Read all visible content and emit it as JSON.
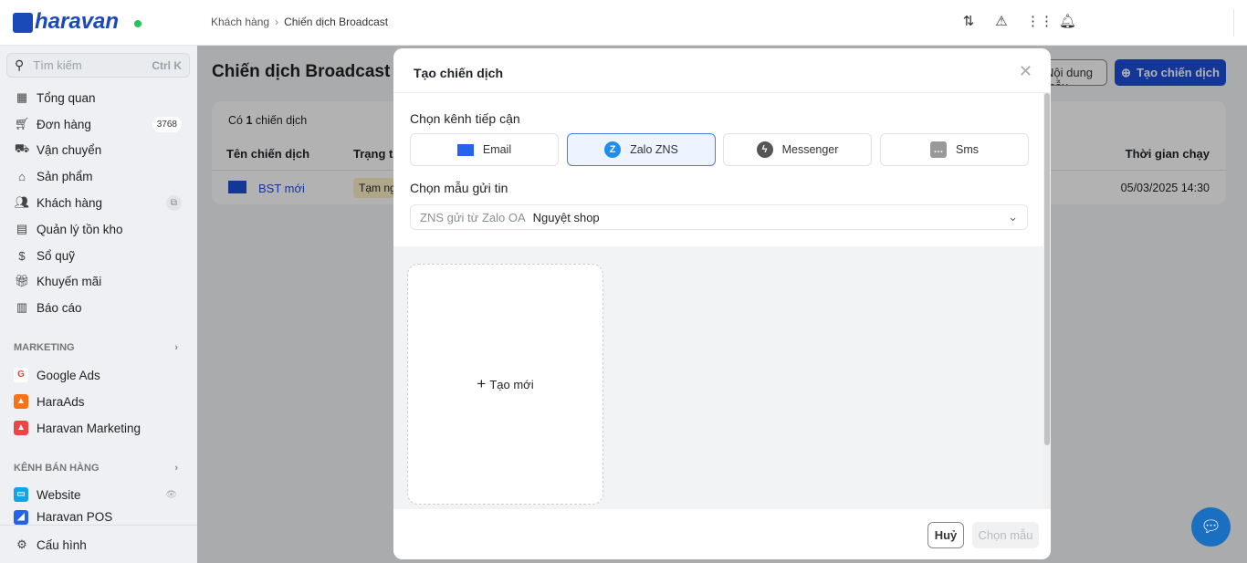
{
  "header": {
    "logo": "haravan",
    "breadcrumb": [
      "Khách hàng",
      "Chiến dịch Broadcast"
    ]
  },
  "sidebar": {
    "search_placeholder": "Tìm kiếm",
    "search_shortcut": "Ctrl K",
    "items": [
      {
        "label": "Tổng quan"
      },
      {
        "label": "Đơn hàng",
        "badge": "3768"
      },
      {
        "label": "Vận chuyển"
      },
      {
        "label": "Sản phẩm"
      },
      {
        "label": "Khách hàng"
      },
      {
        "label": "Quản lý tồn kho"
      },
      {
        "label": "Sổ quỹ"
      },
      {
        "label": "Khuyến mãi"
      },
      {
        "label": "Báo cáo"
      }
    ],
    "marketing_title": "MARKETING",
    "marketing": [
      {
        "label": "Google Ads"
      },
      {
        "label": "HaraAds"
      },
      {
        "label": "Haravan Marketing"
      }
    ],
    "channels_title": "KÊNH BÁN HÀNG",
    "channels": [
      {
        "label": "Website"
      },
      {
        "label": "Haravan POS"
      }
    ],
    "settings": "Cấu hình"
  },
  "page": {
    "title": "Chiến dịch Broadcast",
    "template_button": "Nội dung mẫu",
    "create_button": "Tạo chiến dịch",
    "count_prefix": "Có ",
    "count": "1",
    "count_suffix": " chiến dịch",
    "columns": [
      "Tên chiến dịch",
      "Trạng thái",
      "Thời gian chạy"
    ],
    "rows": [
      {
        "name": "BST mới",
        "status": "Tạm ngưng",
        "time": "05/03/2025 14:30"
      }
    ]
  },
  "modal": {
    "title": "Tạo chiến dịch",
    "channel_label": "Chọn kênh tiếp cận",
    "channels": [
      "Email",
      "Zalo ZNS",
      "Messenger",
      "Sms"
    ],
    "selected_channel": "Zalo ZNS",
    "template_label": "Chọn mẫu gửi tin",
    "select_prefix": "ZNS gửi từ Zalo OA",
    "select_value": "Nguyệt shop",
    "new_card": "Tạo mới",
    "cancel": "Huỷ",
    "choose": "Chọn mẫu"
  },
  "colors": {
    "primary": "#1d4fd8",
    "online": "#22c55e"
  }
}
